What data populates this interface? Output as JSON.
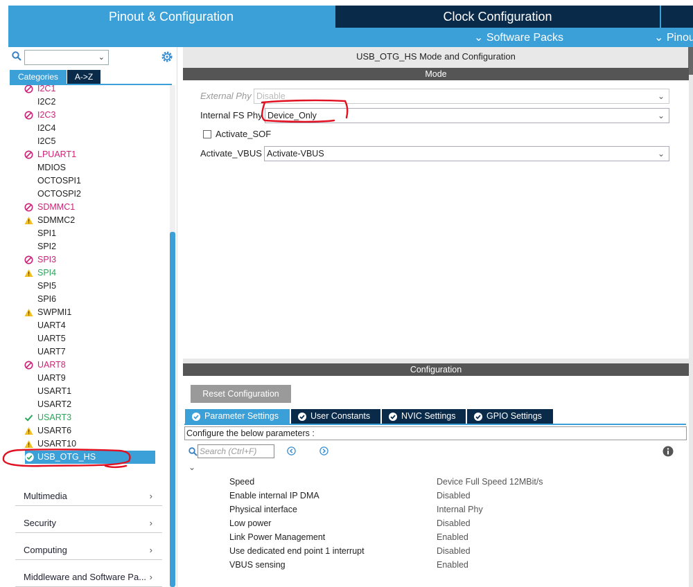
{
  "header": {
    "tab_pinout": "Pinout & Configuration",
    "tab_clock": "Clock Configuration",
    "software_packs": "Software Packs",
    "pinout_menu": "Pinout"
  },
  "sidebar": {
    "tab_categories": "Categories",
    "tab_az": "A->Z",
    "peripherals": [
      {
        "label": "I2C1",
        "status": "disabled"
      },
      {
        "label": "I2C2",
        "status": "none"
      },
      {
        "label": "I2C3",
        "status": "disabled"
      },
      {
        "label": "I2C4",
        "status": "none"
      },
      {
        "label": "I2C5",
        "status": "none"
      },
      {
        "label": "LPUART1",
        "status": "disabled"
      },
      {
        "label": "MDIOS",
        "status": "none"
      },
      {
        "label": "OCTOSPI1",
        "status": "none"
      },
      {
        "label": "OCTOSPI2",
        "status": "none"
      },
      {
        "label": "SDMMC1",
        "status": "disabled"
      },
      {
        "label": "SDMMC2",
        "status": "warning"
      },
      {
        "label": "SPI1",
        "status": "none"
      },
      {
        "label": "SPI2",
        "status": "none"
      },
      {
        "label": "SPI3",
        "status": "disabled"
      },
      {
        "label": "SPI4",
        "status": "warning-green"
      },
      {
        "label": "SPI5",
        "status": "none"
      },
      {
        "label": "SPI6",
        "status": "none"
      },
      {
        "label": "SWPMI1",
        "status": "warning"
      },
      {
        "label": "UART4",
        "status": "none"
      },
      {
        "label": "UART5",
        "status": "none"
      },
      {
        "label": "UART7",
        "status": "none"
      },
      {
        "label": "UART8",
        "status": "disabled"
      },
      {
        "label": "UART9",
        "status": "none"
      },
      {
        "label": "USART1",
        "status": "none"
      },
      {
        "label": "USART2",
        "status": "none"
      },
      {
        "label": "USART3",
        "status": "ok"
      },
      {
        "label": "USART6",
        "status": "warning"
      },
      {
        "label": "USART10",
        "status": "warning"
      },
      {
        "label": "USB_OTG_HS",
        "status": "selected"
      }
    ],
    "categories": [
      {
        "label": "Multimedia"
      },
      {
        "label": "Security"
      },
      {
        "label": "Computing"
      },
      {
        "label": "Middleware and Software Pa..."
      }
    ]
  },
  "mode": {
    "title": "USB_OTG_HS Mode and Configuration",
    "section": "Mode",
    "external_phy_label": "External Phy",
    "external_phy_value": "Disable",
    "internal_fs_phy_label": "Internal FS Phy",
    "internal_fs_phy_value": "Device_Only",
    "activate_sof_label": "Activate_SOF",
    "activate_vbus_label": "Activate_VBUS",
    "activate_vbus_value": "Activate-VBUS"
  },
  "config": {
    "section": "Configuration",
    "reset_button": "Reset Configuration",
    "tabs": [
      {
        "label": "Parameter Settings"
      },
      {
        "label": "User Constants"
      },
      {
        "label": "NVIC Settings"
      },
      {
        "label": "GPIO Settings"
      }
    ],
    "description": "Configure the below parameters :",
    "search_placeholder": "Search (Ctrl+F)",
    "params": [
      {
        "name": "Speed",
        "value": "Device Full Speed 12MBit/s"
      },
      {
        "name": "Enable internal IP DMA",
        "value": "Disabled"
      },
      {
        "name": "Physical interface",
        "value": "Internal Phy"
      },
      {
        "name": "Low power",
        "value": "Disabled"
      },
      {
        "name": "Link Power Management",
        "value": "Enabled"
      },
      {
        "name": "Use dedicated end point 1 interrupt",
        "value": "Disabled"
      },
      {
        "name": "VBUS sensing",
        "value": "Enabled"
      }
    ]
  },
  "colors": {
    "accent": "#3ca0d8",
    "navy": "#0a2a4a",
    "disabled_red": "#cc2277",
    "ok_green": "#2aa65a",
    "warning_yellow": "#f0c020",
    "annotation_red": "#e01020"
  }
}
